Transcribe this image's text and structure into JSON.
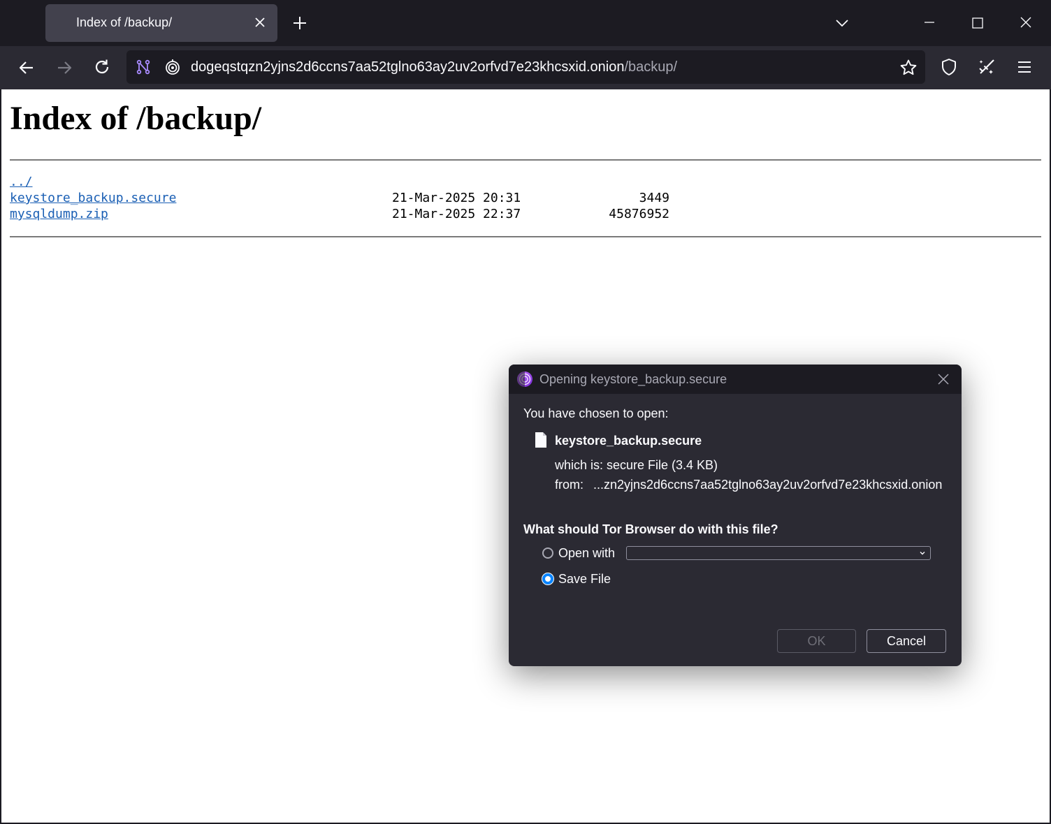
{
  "browser": {
    "tab_title": "Index of /backup/",
    "url_host": "dogeqstqzn2yjns2d6ccns7aa52tglno63ay2uv2orfvd7e23khcsxid.onion",
    "url_path": "/backup/"
  },
  "page": {
    "heading": "Index of /backup/",
    "entries": [
      {
        "name": "../",
        "date": "",
        "size": ""
      },
      {
        "name": "keystore_backup.secure",
        "date": "21-Mar-2025 20:31",
        "size": "3449"
      },
      {
        "name": "mysqldump.zip",
        "date": "21-Mar-2025 22:37",
        "size": "45876952"
      }
    ]
  },
  "dialog": {
    "title": "Opening keystore_backup.secure",
    "chosen_label": "You have chosen to open:",
    "file_name": "keystore_backup.secure",
    "which_is_label": "which is:",
    "which_is_value": "secure File (3.4 KB)",
    "from_label": "from:",
    "from_value": "...zn2yjns2d6ccns7aa52tglno63ay2uv2orfvd7e23khcsxid.onion",
    "question": "What should Tor Browser do with this file?",
    "open_with_label": "Open with",
    "open_with_value": "",
    "save_file_label": "Save File",
    "selected_option": "save_file",
    "ok_label": "OK",
    "cancel_label": "Cancel"
  },
  "colors": {
    "accent": "#0a84ff",
    "tor_purple": "#9b4dff",
    "link": "#1a5fb4"
  }
}
